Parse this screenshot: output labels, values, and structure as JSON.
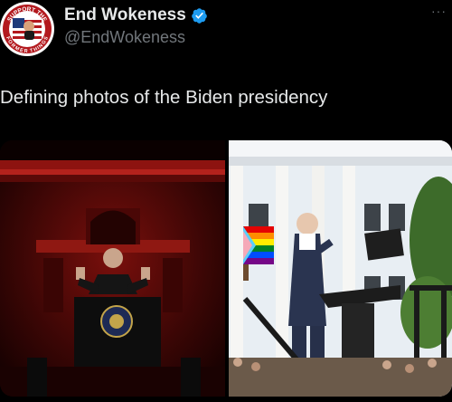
{
  "tweet": {
    "author": {
      "display_name": "End Wokeness",
      "handle": "@EndWokeness",
      "verified": true,
      "verified_icon": "verified-badge-icon",
      "avatar_text_top": "SUPPORT THE",
      "avatar_text_bottom": "FORMER THINGS"
    },
    "more_icon": "more-options-icon",
    "more_label": "···",
    "text": "Defining photos of the Biden presidency",
    "media": [
      {
        "name": "photo-biden-red-stage"
      },
      {
        "name": "photo-biden-white-house-podium"
      }
    ]
  },
  "colors": {
    "background": "#000000",
    "text_primary": "#e7e9ea",
    "text_secondary": "#71767b",
    "verified_blue": "#1d9bf0"
  }
}
